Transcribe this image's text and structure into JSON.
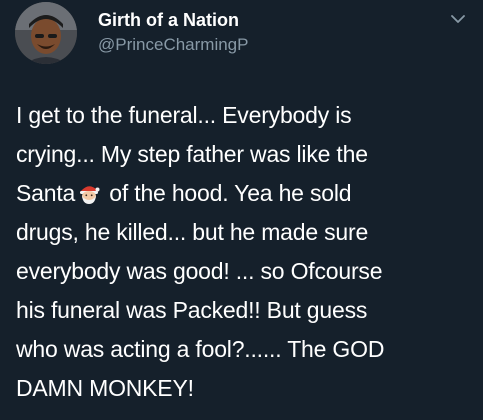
{
  "tweet": {
    "author": {
      "display_name": "Girth of a Nation",
      "handle": "@PrinceCharmingP"
    },
    "text_lines": [
      "I get to the funeral... Everybody is",
      "crying... My step father was like the",
      "of the hood. Yea he sold",
      "drugs, he killed... but he made sure",
      "everybody was good! ... so Ofcourse",
      "his funeral was Packed!! But guess",
      "who was acting a fool?...... The GOD",
      "DAMN MONKEY!"
    ],
    "santa_prefix": "Santa",
    "emoji": {
      "icon": "santa-claus-emoji-icon"
    }
  },
  "colors": {
    "background": "#15202b",
    "text": "#ffffff",
    "secondary_text": "#8899a6"
  }
}
